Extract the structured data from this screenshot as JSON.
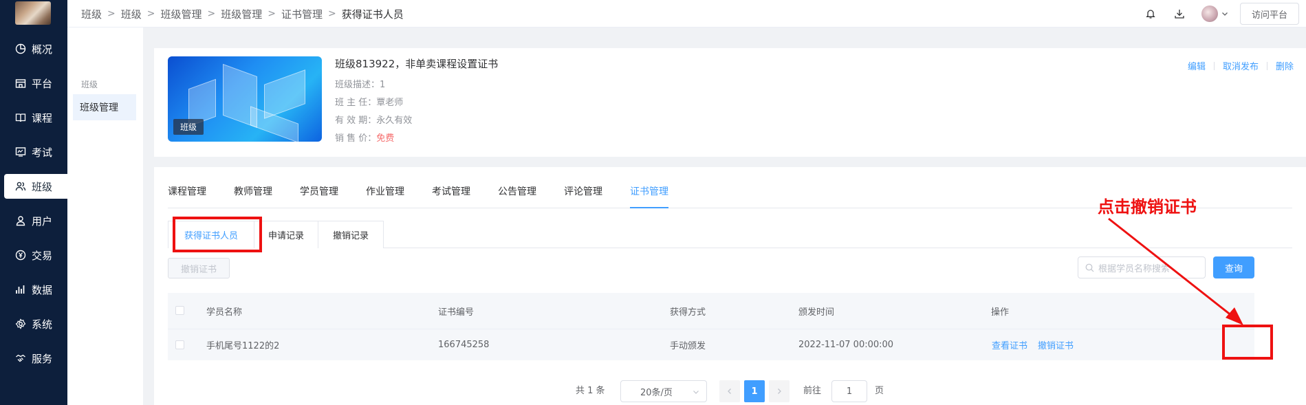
{
  "sidebar": {
    "items": [
      {
        "label": "概况",
        "icon": "pie-chart-icon"
      },
      {
        "label": "平台",
        "icon": "store-icon"
      },
      {
        "label": "课程",
        "icon": "book-icon"
      },
      {
        "label": "考试",
        "icon": "exam-screen-icon"
      },
      {
        "label": "班级",
        "icon": "people-icon"
      },
      {
        "label": "用户",
        "icon": "user-icon"
      },
      {
        "label": "交易",
        "icon": "yen-circle-icon"
      },
      {
        "label": "数据",
        "icon": "bar-chart-icon"
      },
      {
        "label": "系统",
        "icon": "gear-icon"
      },
      {
        "label": "服务",
        "icon": "handshake-icon"
      }
    ],
    "active_index": 4
  },
  "header": {
    "breadcrumb": [
      "班级",
      "班级",
      "班级管理",
      "班级管理",
      "证书管理",
      "获得证书人员"
    ],
    "visit_button": "访问平台"
  },
  "subnav": {
    "group_title": "班级",
    "item": "班级管理"
  },
  "class_card": {
    "cover_tag": "班级",
    "name": "班级813922，非单卖课程设置证书",
    "rows": [
      {
        "label": "班级描述：",
        "value": "1"
      },
      {
        "label": "班 主 任：",
        "value": "覃老师"
      },
      {
        "label": "有 效 期：",
        "value": "永久有效"
      },
      {
        "label": "销 售 价：",
        "value": "免费"
      }
    ],
    "actions": [
      "编辑",
      "取消发布",
      "删除"
    ]
  },
  "tabs": [
    "课程管理",
    "教师管理",
    "学员管理",
    "作业管理",
    "考试管理",
    "公告管理",
    "评论管理",
    "证书管理"
  ],
  "active_tab": "证书管理",
  "subtabs": [
    "获得证书人员",
    "申请记录",
    "撤销记录"
  ],
  "toolbar": {
    "revoke_button": "撤销证书",
    "search_placeholder": "根据学员名称搜索",
    "query_button": "查询"
  },
  "table": {
    "columns": [
      "学员名称",
      "证书编号",
      "获得方式",
      "颁发时间",
      "操作"
    ],
    "rows": [
      {
        "name": "手机尾号1122的2",
        "cert_no": "166745258",
        "method": "手动颁发",
        "issued_at": "2022-11-07 00:00:00",
        "actions": [
          "查看证书",
          "撤销证书"
        ]
      }
    ]
  },
  "pagination": {
    "total": "共 1 条",
    "page_size": "20条/页",
    "current_page": "1",
    "goto_label": "前往",
    "goto_value": "1",
    "page_unit": "页"
  },
  "annotation": {
    "text": "点击撤销证书",
    "color": "#ee1111"
  },
  "colors": {
    "primary": "#409eff",
    "sidebar_bg": "#0d1f3c",
    "danger": "#f56c6c"
  }
}
